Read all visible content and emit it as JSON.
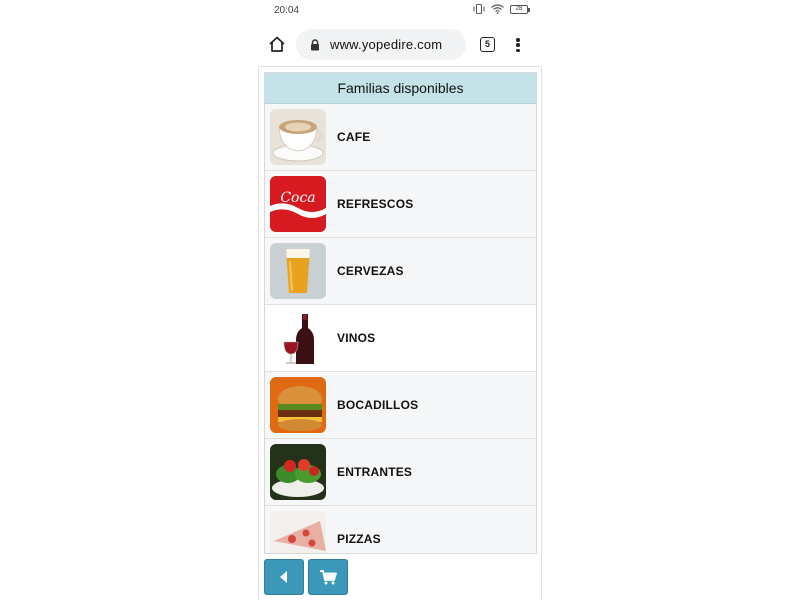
{
  "status_bar": {
    "time": "20:04",
    "battery": "28",
    "icons": [
      "vibrate-icon",
      "wifi-icon",
      "battery-icon"
    ]
  },
  "browser": {
    "url": "www.yopedire.com",
    "tab_count": "5",
    "icons": [
      "home-icon",
      "lock-icon",
      "tabs-icon",
      "overflow-menu-icon"
    ]
  },
  "panel": {
    "title": "Familias disponibles",
    "families": [
      {
        "label": "CAFE",
        "icon": "coffee-cup-image"
      },
      {
        "label": "REFRESCOS",
        "icon": "coca-cola-image"
      },
      {
        "label": "CERVEZAS",
        "icon": "beer-glass-image"
      },
      {
        "label": "VINOS",
        "icon": "wine-bottle-image"
      },
      {
        "label": "BOCADILLOS",
        "icon": "burger-image"
      },
      {
        "label": "ENTRANTES",
        "icon": "salad-image"
      },
      {
        "label": "PIZZAS",
        "icon": "pizza-image"
      }
    ]
  },
  "footer": {
    "buttons": [
      "back-icon",
      "cart-icon"
    ]
  },
  "colors": {
    "header_bg": "#c3e3e8",
    "button_bg": "#3c98b9",
    "list_bg": "#f6f7f8"
  }
}
